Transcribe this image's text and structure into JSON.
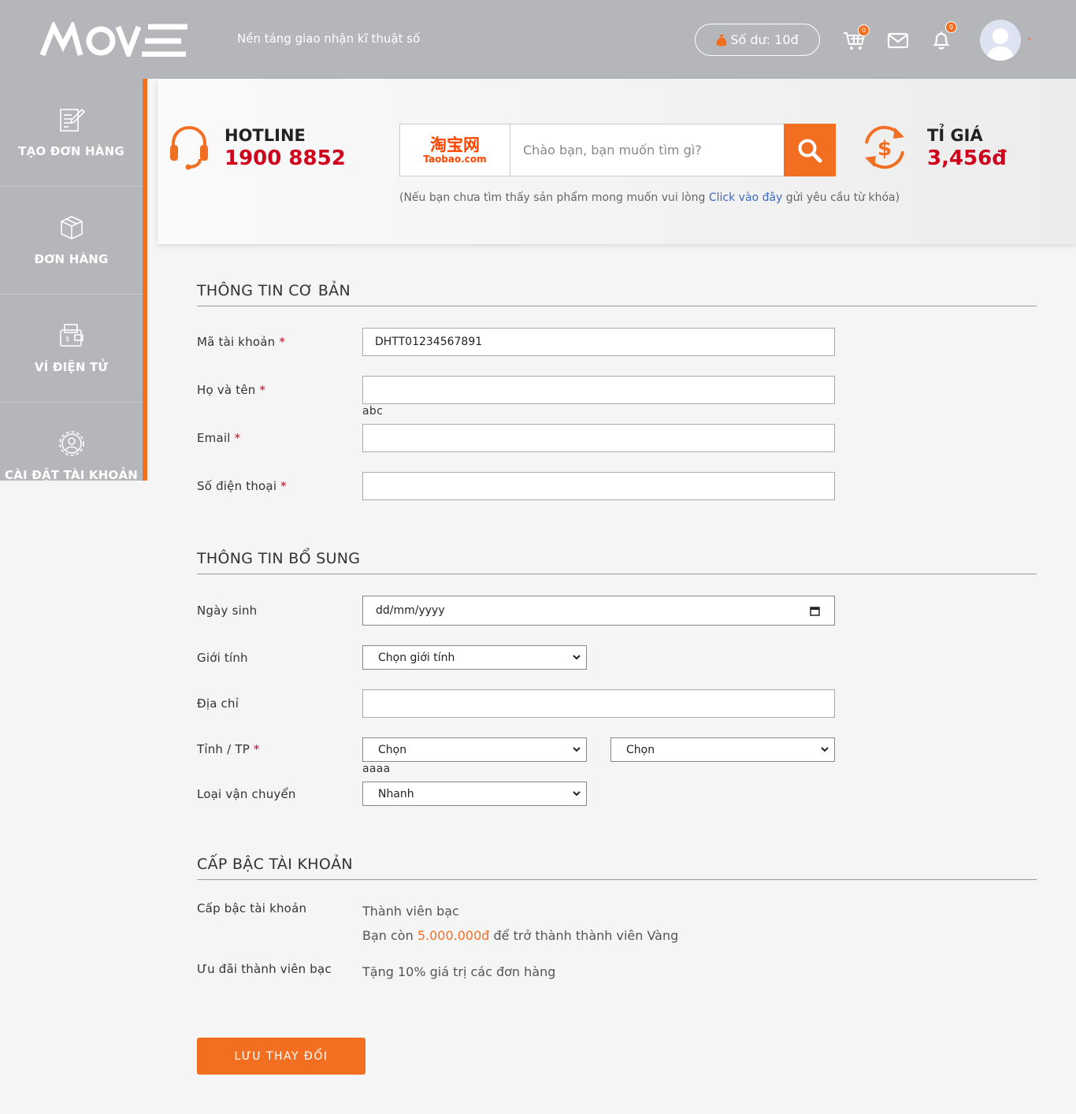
{
  "header": {
    "logo_text": "MOVE",
    "tagline": "Nền tảng giao nhận kĩ thuật số",
    "balance": "Số dư: 10đ",
    "cart_count": "0",
    "notification_count": "0"
  },
  "sidebar": {
    "items": [
      {
        "label": "TẠO ĐƠN HÀNG",
        "icon": "edit-note-icon"
      },
      {
        "label": "ĐƠN HÀNG",
        "icon": "package-box-icon"
      },
      {
        "label": "VÍ ĐIỆN TỬ",
        "icon": "wallet-icon"
      },
      {
        "label": "CÀI ĐẶT TÀI KHOẢN",
        "icon": "settings-user-icon"
      }
    ]
  },
  "banner": {
    "hotline_label": "HOTLINE",
    "hotline_number": "1900 8852",
    "taobao_cn": "淘宝网",
    "taobao_en": "Taobao.com",
    "search_placeholder": "Chào bạn, bạn muốn tìm gì?",
    "note_prefix": "(Nếu bạn chưa tìm thấy sản phẩm mong muốn vui lòng ",
    "note_link": "Click vào đây",
    "note_suffix": " gửi yêu cầu từ khóa)",
    "rate_label": "TỈ GIÁ",
    "rate_value": "3,456đ"
  },
  "basic_info": {
    "title": "THÔNG TIN CƠ BẢN",
    "account_id_label": "Mã tài khoản",
    "account_id_value": "DHTT01234567891",
    "fullname_label": "Họ và tên",
    "fullname_value": "",
    "fullname_hint": "abc",
    "email_label": "Email",
    "email_value": "",
    "phone_label": "Số điện thoại",
    "phone_value": "",
    "required_mark": "*"
  },
  "extra_info": {
    "title": "THÔNG TIN BỔ SUNG",
    "dob_label": "Ngày sinh",
    "dob_placeholder": "dd/mm/yyyy",
    "gender_label": "Giới tính",
    "gender_selected": "Chọn giới tính",
    "address_label": "Địa chỉ",
    "address_value": "",
    "province_label": "Tỉnh / TP",
    "province_selected": "Chọn",
    "district_selected": "Chọn",
    "province_hint": "aaaa",
    "shipping_label": "Loại vận chuyển",
    "shipping_selected": "Nhanh"
  },
  "tier": {
    "title": "CẤP BẬC TÀI KHOẢN",
    "tier_label": "Cấp bậc tài khoản",
    "tier_value": "Thành viên bạc",
    "progress_prefix": "Bạn còn ",
    "progress_amount": "5.000.000đ",
    "progress_suffix": " để trở thành thành viên Vàng",
    "benefit_label": "Ưu đãi thành viên bạc",
    "benefit_value": "Tặng 10% giá trị các đơn hàng"
  },
  "actions": {
    "save_label": "LƯU THAY ĐỔI"
  },
  "colors": {
    "accent": "#f26f21",
    "header_bg": "#b5b6b9",
    "highlight_red": "#d0021b",
    "link_blue": "#3b6cc4"
  }
}
